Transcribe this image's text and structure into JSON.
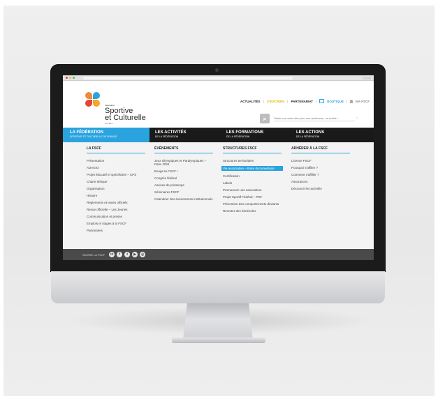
{
  "header": {
    "brand_small": "Fédération",
    "brand_line1": "Sportive",
    "brand_line2": "et Culturelle",
    "brand_foot": "de France",
    "nav": [
      {
        "label": "ACTUALITÉS"
      },
      {
        "label": "S'INSCRIRE"
      },
      {
        "label": "PARTENARIAT"
      },
      {
        "label": "BOUTIQUE"
      },
      {
        "label": "MA FSCF"
      }
    ],
    "search_placeholder": "Saisir vos mots-clés pour une recherche, un article..."
  },
  "main_nav": [
    {
      "title": "LA FÉDÉRATION",
      "subtitle": "SPORTIVE ET CULTURELLE DE FRANCE",
      "active": true
    },
    {
      "title": "LES ACTIVITÉS",
      "subtitle": "DE LA FÉDÉRATION"
    },
    {
      "title": "LES FORMATIONS",
      "subtitle": "DE LA FÉDÉRATION"
    },
    {
      "title": "LES ACTIONS",
      "subtitle": "DE LA FÉDÉRATION"
    }
  ],
  "columns": [
    {
      "heading": "LA FSCF",
      "items": [
        "Présentation",
        "ADAGIO",
        "Projet éducatif et spécificités – CPS",
        "Charte éthique",
        "Organisation",
        "Histoire",
        "Règlements et textes officiels",
        "Revue officielle – Les Jeunes",
        "Communication et presse",
        "Emplois et stages à la FSCF",
        "Partenaires"
      ]
    },
    {
      "heading": "ÉVÉNEMENTS",
      "items": [
        "Jeux Olympiques et Paralympiques – Paris 2024",
        "Bouge ta FSCF !",
        "Congrès fédéral",
        "Assises de printemps",
        "Séminaires FSCF",
        "Calendrier des événements institutionnels"
      ]
    },
    {
      "heading": "STRUCTURES FSCF",
      "items": [
        "Structures territoriales",
        "Vie associative – Base documentaire",
        "Certification",
        "Labels",
        "Promouvoir une association",
        "Projet Sportif Fédéral – PSF",
        "Prévention des comportements déviants",
        "Recruter des bénévoles"
      ],
      "selected_index": 1
    },
    {
      "heading": "ADHÉRER À LA FSCF",
      "items": [
        "Licence FSCF",
        "Pourquoi s'affilier ?",
        "Comment s'affilier ?",
        "Assurances",
        "Découvrir les activités"
      ]
    }
  ],
  "footer": {
    "follow_label": "SUIVRE LA FSCF",
    "social": [
      "linkedin-icon",
      "facebook-icon",
      "twitter-icon",
      "youtube-icon",
      "instagram-icon"
    ]
  },
  "colors": {
    "accent": "#2aa3df",
    "highlight": "#e8b800",
    "nav_bg": "#1a1a1a",
    "logo_red": "#e2463a",
    "logo_orange": "#f5a623"
  }
}
